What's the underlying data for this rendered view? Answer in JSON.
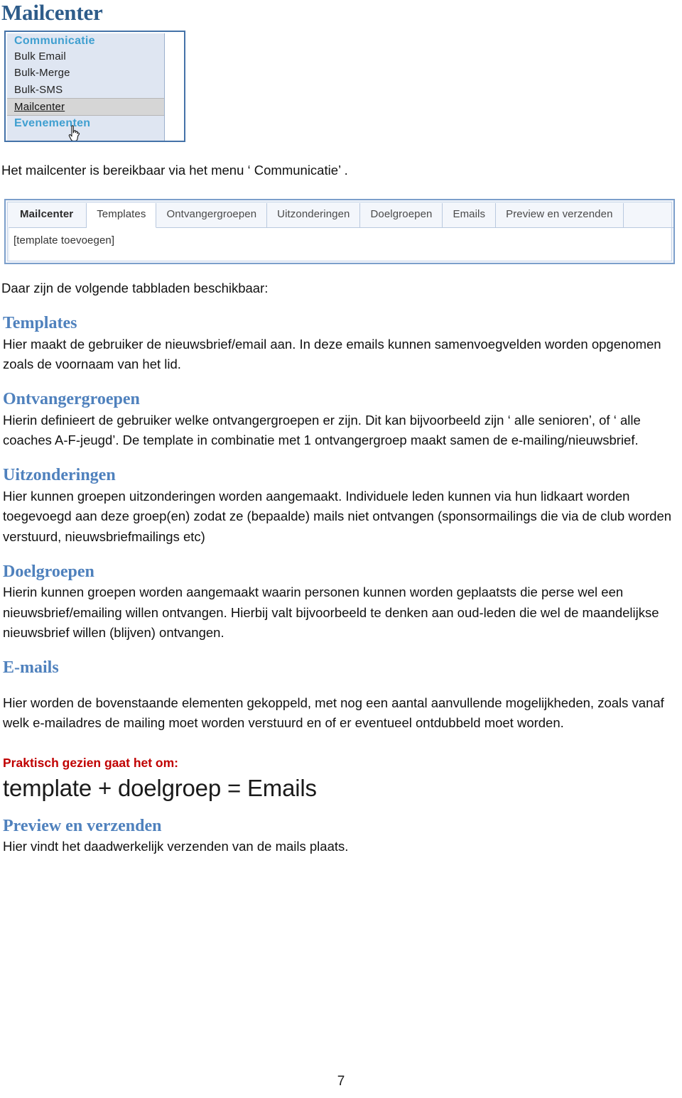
{
  "document": {
    "title": "Mailcenter",
    "page_number": "7"
  },
  "menu_screenshot": {
    "group_title": "Communicatie",
    "items": [
      {
        "label": "Bulk Email",
        "selected": false
      },
      {
        "label": "Bulk-Merge",
        "selected": false
      },
      {
        "label": "Bulk-SMS",
        "selected": false
      },
      {
        "label": "Mailcenter",
        "selected": true
      }
    ],
    "next_group_title": "Evenementen",
    "cursor": "hand-pointer-cursor"
  },
  "intro": {
    "line": "Het mailcenter is bereikbaar via het menu ‘ Communicatie’ ."
  },
  "tabs_screenshot": {
    "section_label": "Mailcenter",
    "tabs": [
      {
        "label": "Templates",
        "active": true
      },
      {
        "label": "Ontvangergroepen",
        "active": false
      },
      {
        "label": "Uitzonderingen",
        "active": false
      },
      {
        "label": "Doelgroepen",
        "active": false
      },
      {
        "label": "Emails",
        "active": false
      },
      {
        "label": "Preview en verzenden",
        "active": false
      }
    ],
    "body_link": "[template toevoegen]"
  },
  "after_tabs": {
    "line": "Daar zijn de volgende tabbladen beschikbaar:"
  },
  "sections": [
    {
      "heading": "Templates",
      "body": "Hier maakt de gebruiker de nieuwsbrief/email aan. In deze emails kunnen samenvoegvelden worden opgenomen zoals de voornaam van het lid."
    },
    {
      "heading": "Ontvangergroepen",
      "body": "Hierin definieert de gebruiker welke ontvangergroepen er zijn. Dit kan bijvoorbeeld zijn ‘ alle senioren’, of ‘ alle coaches A-F-jeugd’. De template in combinatie met 1 ontvangergroep maakt samen de e-mailing/nieuwsbrief."
    },
    {
      "heading": "Uitzonderingen",
      "body": "Hier kunnen groepen uitzonderingen worden aangemaakt. Individuele leden kunnen via hun lidkaart worden toegevoegd aan deze groep(en) zodat ze (bepaalde) mails niet ontvangen (sponsormailings die via de club worden verstuurd, nieuwsbriefmailings etc)"
    },
    {
      "heading": "Doelgroepen",
      "body": "Hierin kunnen groepen worden aangemaakt waarin personen kunnen worden geplaatsts die perse wel een nieuwsbrief/emailing willen ontvangen. Hierbij valt bijvoorbeeld te denken aan oud-leden die wel de maandelijkse nieuwsbrief willen (blijven) ontvangen."
    },
    {
      "heading": "E-mails",
      "body": "Hier worden de bovenstaande elementen gekoppeld, met nog een aantal aanvullende mogelijkheden, zoals vanaf welk e-mailadres de mailing moet worden verstuurd en of er eventueel ontdubbeld moet worden."
    }
  ],
  "practical": {
    "heading": "Praktisch gezien gaat het om:",
    "formula": "template + doelgroep = Emails"
  },
  "preview_section": {
    "heading": "Preview en verzenden",
    "body": "Hier vindt het daadwerkelijk verzenden van de mails plaats."
  },
  "colors": {
    "title_blue": "#2E5C8A",
    "heading_blue": "#4F81BD",
    "accent_red": "#C00000",
    "menu_group_blue": "#3f9fd0",
    "menu_background": "#dfe6f2",
    "menu_border": "#4472a8",
    "menu_selected": "#d6d6d6",
    "tabs_border": "#7c9fcb"
  }
}
